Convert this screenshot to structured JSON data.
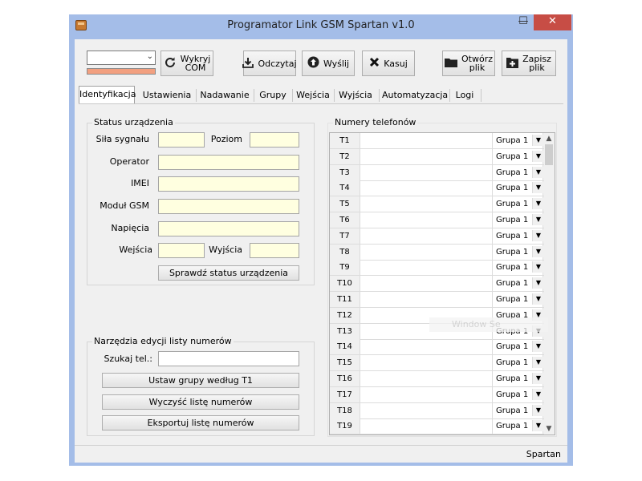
{
  "window": {
    "title": "Programator Link GSM Spartan v1.0",
    "min_glyph": "—",
    "max_glyph": "☐",
    "close_glyph": "✕",
    "status_text": "Spartan"
  },
  "toolbar": {
    "port_combo_value": "",
    "progress_percent": 100,
    "progress_color": "#f2a080",
    "detect_label_line1": "Wykryj",
    "detect_label_line2": "COM",
    "read_label": "Odczytaj",
    "send_label": "Wyślij",
    "delete_label": "Kasuj",
    "open_label_line1": "Otwórz",
    "open_label_line2": "plik",
    "save_label_line1": "Zapisz",
    "save_label_line2": "plik",
    "icons": [
      "refresh-icon",
      "download-icon",
      "upload-icon",
      "delete-x-icon",
      "folder-icon",
      "save-plus-icon"
    ]
  },
  "tabs": [
    {
      "label": "Identyfikacja",
      "selected": true
    },
    {
      "label": "Ustawienia"
    },
    {
      "label": "Nadawanie"
    },
    {
      "label": "Grupy"
    },
    {
      "label": "Wejścia"
    },
    {
      "label": "Wyjścia"
    },
    {
      "label": "Automatyzacja"
    },
    {
      "label": "Logi"
    }
  ],
  "status_group": {
    "title": "Status urządzenia",
    "signal_label": "Siła sygnału",
    "level_label": "Poziom",
    "operator_label": "Operator",
    "imei_label": "IMEI",
    "gsm_module_label": "Moduł GSM",
    "voltage_label": "Napięcia",
    "inputs_label": "Wejścia",
    "outputs_label": "Wyjścia",
    "check_button": "Sprawdź status urządzenia"
  },
  "tools_group": {
    "title": "Narzędzia edycji listy numerów",
    "search_label": "Szukaj tel.:",
    "search_value": "",
    "set_groups_button": "Ustaw grupy według T1",
    "clear_button": "Wyczyść listę numerów",
    "export_button": "Eksportuj listę numerów"
  },
  "phones": {
    "title": "Numery telefonów",
    "rows": [
      {
        "id": "T1",
        "number": "",
        "group": "Grupa 1"
      },
      {
        "id": "T2",
        "number": "",
        "group": "Grupa 1"
      },
      {
        "id": "T3",
        "number": "",
        "group": "Grupa 1"
      },
      {
        "id": "T4",
        "number": "",
        "group": "Grupa 1"
      },
      {
        "id": "T5",
        "number": "",
        "group": "Grupa 1"
      },
      {
        "id": "T6",
        "number": "",
        "group": "Grupa 1"
      },
      {
        "id": "T7",
        "number": "",
        "group": "Grupa 1"
      },
      {
        "id": "T8",
        "number": "",
        "group": "Grupa 1"
      },
      {
        "id": "T9",
        "number": "",
        "group": "Grupa 1"
      },
      {
        "id": "T10",
        "number": "",
        "group": "Grupa 1"
      },
      {
        "id": "T11",
        "number": "",
        "group": "Grupa 1"
      },
      {
        "id": "T12",
        "number": "",
        "group": "Grupa 1"
      },
      {
        "id": "T13",
        "number": "",
        "group": "Grupa 1"
      },
      {
        "id": "T14",
        "number": "",
        "group": "Grupa 1"
      },
      {
        "id": "T15",
        "number": "",
        "group": "Grupa 1"
      },
      {
        "id": "T16",
        "number": "",
        "group": "Grupa 1"
      },
      {
        "id": "T17",
        "number": "",
        "group": "Grupa 1"
      },
      {
        "id": "T18",
        "number": "",
        "group": "Grupa 1"
      },
      {
        "id": "T19",
        "number": "",
        "group": "Grupa 1"
      }
    ],
    "watermark": "Window Se"
  }
}
